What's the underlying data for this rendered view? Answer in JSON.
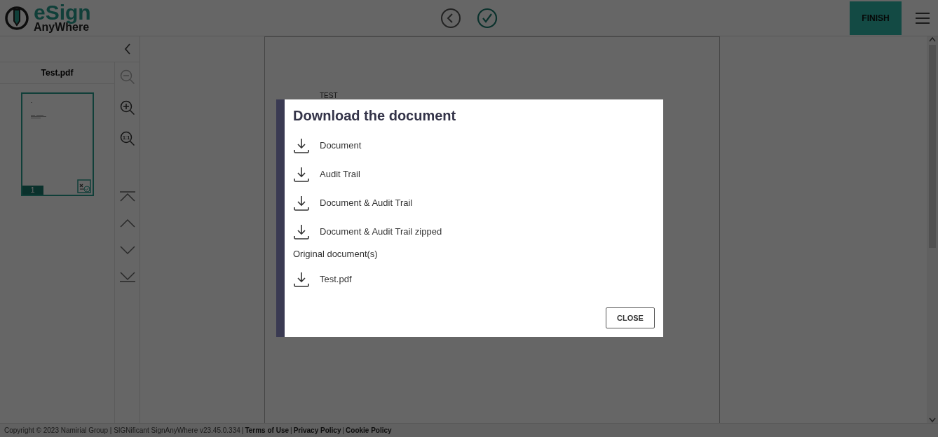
{
  "header": {
    "logo": {
      "line1": "eSign",
      "line2": "AnyWhere"
    },
    "finish_button": "FINISH"
  },
  "sidebar": {
    "document_name": "Test.pdf",
    "zoom_reset_label": "1:1",
    "thumbnails": [
      {
        "page": "1",
        "selected": true
      }
    ]
  },
  "document": {
    "page_text": "TEST"
  },
  "dialog": {
    "title": "Download the document",
    "close_button": "CLOSE",
    "items": [
      {
        "kind": "download",
        "label": "Document"
      },
      {
        "kind": "download",
        "label": "Audit Trail"
      },
      {
        "kind": "download",
        "label": "Document & Audit Trail"
      },
      {
        "kind": "download",
        "label": "Document & Audit Trail zipped"
      },
      {
        "kind": "heading",
        "label": "Original document(s)"
      },
      {
        "kind": "download",
        "label": "Test.pdf"
      }
    ]
  },
  "footer": {
    "copyright": "Copyright © 2023 Namirial Group | SIGNificant SignAnyWhere v23.45.0.334",
    "separator": "|",
    "links": [
      "Terms of Use",
      "Privacy Policy",
      "Cookie Policy"
    ]
  }
}
